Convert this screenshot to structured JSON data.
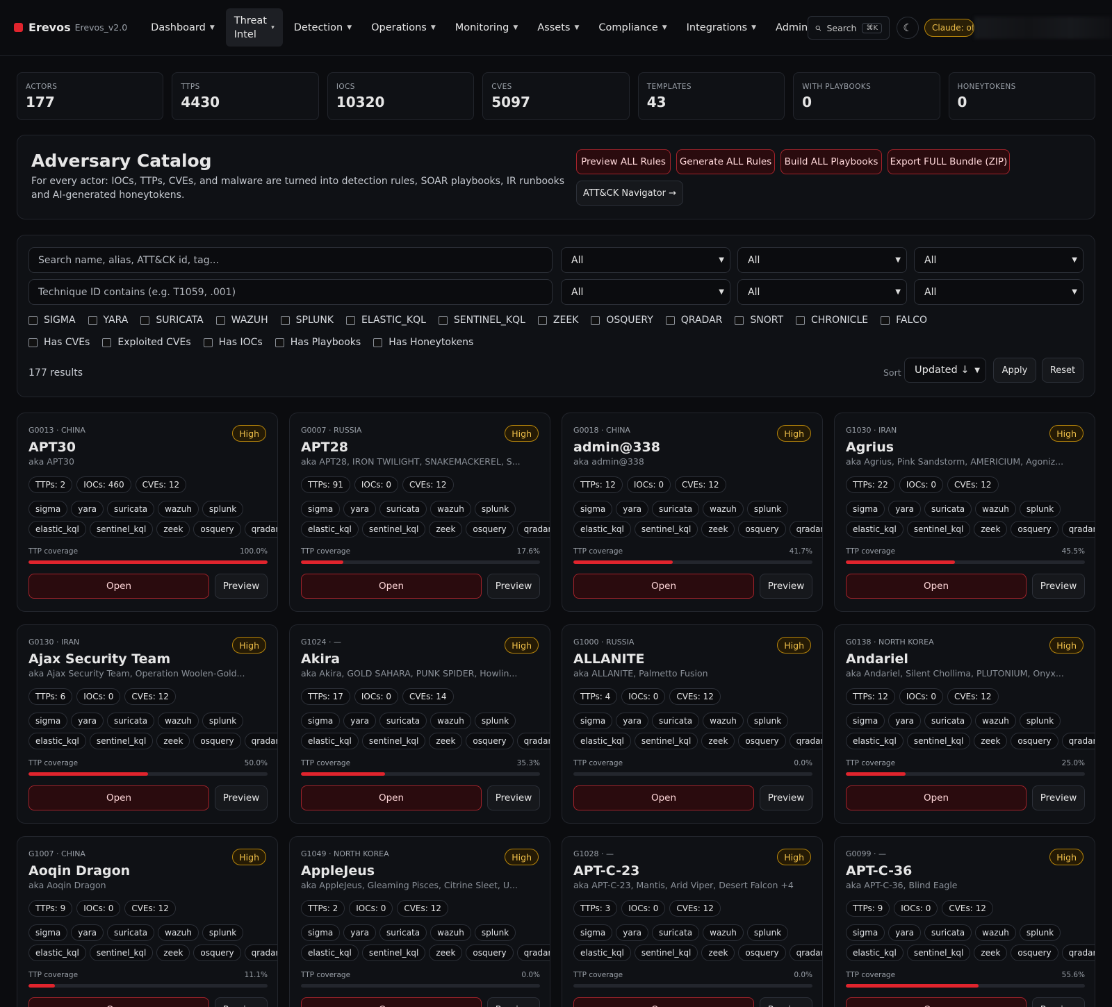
{
  "app": {
    "name": "Erevos",
    "version": "Erevos_v2.0"
  },
  "nav": [
    {
      "label": "Dashboard",
      "active": false
    },
    {
      "label": "Threat Intel",
      "active": true
    },
    {
      "label": "Detection",
      "active": false
    },
    {
      "label": "Operations",
      "active": false
    },
    {
      "label": "Monitoring",
      "active": false
    },
    {
      "label": "Assets",
      "active": false
    },
    {
      "label": "Compliance",
      "active": false
    },
    {
      "label": "Integrations",
      "active": false
    },
    {
      "label": "Admin",
      "active": false
    }
  ],
  "search": {
    "label": "Search",
    "shortcut": "⌘K"
  },
  "claude_status": "Claude: offl",
  "stats": [
    {
      "label": "ACTORS",
      "value": "177"
    },
    {
      "label": "TTPS",
      "value": "4430"
    },
    {
      "label": "IOCS",
      "value": "10320"
    },
    {
      "label": "CVES",
      "value": "5097"
    },
    {
      "label": "TEMPLATES",
      "value": "43"
    },
    {
      "label": "WITH PLAYBOOKS",
      "value": "0"
    },
    {
      "label": "HONEYTOKENS",
      "value": "0"
    }
  ],
  "catalog": {
    "title": "Adversary Catalog",
    "description": "For every actor: IOCs, TTPs, CVEs, and malware are turned into detection rules, SOAR playbooks, IR runbooks and AI-generated honeytokens.",
    "actions": [
      "Preview ALL Rules",
      "Generate ALL Rules",
      "Build ALL Playbooks",
      "Export FULL Bundle (ZIP)"
    ],
    "navigator": "ATT&CK Navigator →"
  },
  "filters": {
    "search_placeholder": "Search name, alias, ATT&CK id, tag...",
    "technique_placeholder": "Technique ID contains (e.g. T1059, .001)",
    "selects": [
      "All",
      "All",
      "All",
      "All",
      "All",
      "All"
    ],
    "engines": [
      "SIGMA",
      "YARA",
      "SURICATA",
      "WAZUH",
      "SPLUNK",
      "ELASTIC_KQL",
      "SENTINEL_KQL",
      "ZEEK",
      "OSQUERY",
      "QRADAR",
      "SNORT",
      "CHRONICLE",
      "FALCO"
    ],
    "flags": [
      "Has CVEs",
      "Exploited CVEs",
      "Has IOCs",
      "Has Playbooks",
      "Has Honeytokens"
    ],
    "results": "177 results",
    "sort_label": "Sort",
    "sort_value": "Updated ↓",
    "apply": "Apply",
    "reset": "Reset"
  },
  "card_labels": {
    "coverage": "TTP coverage",
    "open": "Open",
    "preview": "Preview"
  },
  "tags_row1": [
    "sigma",
    "yara",
    "suricata",
    "wazuh",
    "splunk"
  ],
  "tags_row2": [
    "elastic_kql",
    "sentinel_kql",
    "zeek",
    "osquery",
    "qradar"
  ],
  "actors": [
    {
      "meta": "G0013 · CHINA",
      "risk": "High",
      "name": "APT30",
      "aka": "aka APT30",
      "ttps": "TTPs: 2",
      "iocs": "IOCs: 460",
      "cves": "CVEs: 12",
      "coverage_label": "100.0%",
      "coverage": 100.0
    },
    {
      "meta": "G0007 · RUSSIA",
      "risk": "High",
      "name": "APT28",
      "aka": "aka APT28, IRON TWILIGHT, SNAKEMACKEREL, S...",
      "ttps": "TTPs: 91",
      "iocs": "IOCs: 0",
      "cves": "CVEs: 12",
      "coverage_label": "17.6%",
      "coverage": 17.6
    },
    {
      "meta": "G0018 · CHINA",
      "risk": "High",
      "name": "admin@338",
      "aka": "aka admin@338",
      "ttps": "TTPs: 12",
      "iocs": "IOCs: 0",
      "cves": "CVEs: 12",
      "coverage_label": "41.7%",
      "coverage": 41.7
    },
    {
      "meta": "G1030 · IRAN",
      "risk": "High",
      "name": "Agrius",
      "aka": "aka Agrius, Pink Sandstorm, AMERICIUM, Agoniz...",
      "ttps": "TTPs: 22",
      "iocs": "IOCs: 0",
      "cves": "CVEs: 12",
      "coverage_label": "45.5%",
      "coverage": 45.5
    },
    {
      "meta": "G0130 · IRAN",
      "risk": "High",
      "name": "Ajax Security Team",
      "aka": "aka Ajax Security Team, Operation Woolen-Gold...",
      "ttps": "TTPs: 6",
      "iocs": "IOCs: 0",
      "cves": "CVEs: 12",
      "coverage_label": "50.0%",
      "coverage": 50.0
    },
    {
      "meta": "G1024 · —",
      "risk": "High",
      "name": "Akira",
      "aka": "aka Akira, GOLD SAHARA, PUNK SPIDER, Howlin...",
      "ttps": "TTPs: 17",
      "iocs": "IOCs: 0",
      "cves": "CVEs: 14",
      "coverage_label": "35.3%",
      "coverage": 35.3
    },
    {
      "meta": "G1000 · RUSSIA",
      "risk": "High",
      "name": "ALLANITE",
      "aka": "aka ALLANITE, Palmetto Fusion",
      "ttps": "TTPs: 4",
      "iocs": "IOCs: 0",
      "cves": "CVEs: 12",
      "coverage_label": "0.0%",
      "coverage": 0.0
    },
    {
      "meta": "G0138 · NORTH KOREA",
      "risk": "High",
      "name": "Andariel",
      "aka": "aka Andariel, Silent Chollima, PLUTONIUM, Onyx...",
      "ttps": "TTPs: 12",
      "iocs": "IOCs: 0",
      "cves": "CVEs: 12",
      "coverage_label": "25.0%",
      "coverage": 25.0
    },
    {
      "meta": "G1007 · CHINA",
      "risk": "High",
      "name": "Aoqin Dragon",
      "aka": "aka Aoqin Dragon",
      "ttps": "TTPs: 9",
      "iocs": "IOCs: 0",
      "cves": "CVEs: 12",
      "coverage_label": "11.1%",
      "coverage": 11.1
    },
    {
      "meta": "G1049 · NORTH KOREA",
      "risk": "High",
      "name": "AppleJeus",
      "aka": "aka AppleJeus, Gleaming Pisces, Citrine Sleet, U...",
      "ttps": "TTPs: 2",
      "iocs": "IOCs: 0",
      "cves": "CVEs: 12",
      "coverage_label": "0.0%",
      "coverage": 0.0
    },
    {
      "meta": "G1028 · —",
      "risk": "High",
      "name": "APT-C-23",
      "aka": "aka APT-C-23, Mantis, Arid Viper, Desert Falcon +4",
      "ttps": "TTPs: 3",
      "iocs": "IOCs: 0",
      "cves": "CVEs: 12",
      "coverage_label": "0.0%",
      "coverage": 0.0
    },
    {
      "meta": "G0099 · —",
      "risk": "High",
      "name": "APT-C-36",
      "aka": "aka APT-C-36, Blind Eagle",
      "ttps": "TTPs: 9",
      "iocs": "IOCs: 0",
      "cves": "CVEs: 12",
      "coverage_label": "55.6%",
      "coverage": 55.6
    }
  ],
  "colors": {
    "accent": "#e0242d",
    "warning": "#f0c04a",
    "background": "#0b0c0f"
  }
}
